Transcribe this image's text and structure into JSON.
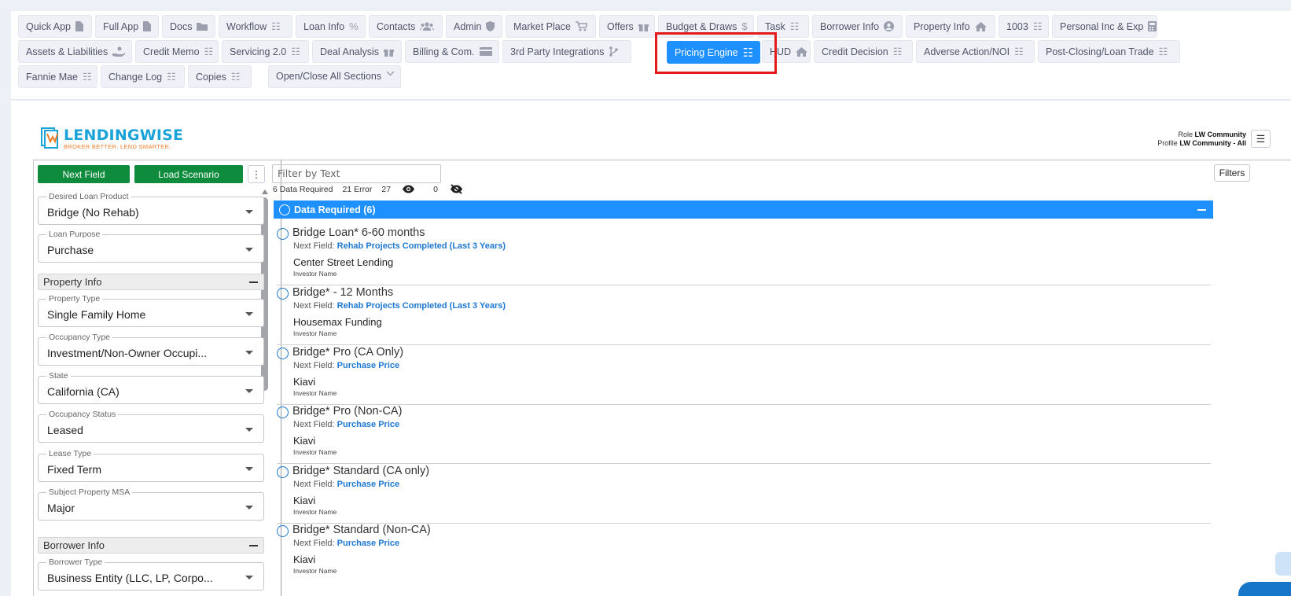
{
  "tabs_row1": [
    {
      "label": "Quick App",
      "icon": "file-icon"
    },
    {
      "label": "Full App",
      "icon": "file-icon"
    },
    {
      "label": "Docs",
      "icon": "folder-icon"
    },
    {
      "label": "Workflow",
      "icon": "list-icon"
    },
    {
      "label": "Loan Info",
      "icon": "percent-icon"
    },
    {
      "label": "Contacts",
      "icon": "users-icon"
    },
    {
      "label": "Admin",
      "icon": "shield-icon"
    },
    {
      "label": "Market Place",
      "icon": "cart-icon"
    },
    {
      "label": "Offers",
      "icon": "gift-icon"
    },
    {
      "label": "Budget & Draws",
      "icon": "dollar-icon"
    },
    {
      "label": "Task",
      "icon": "list-icon"
    },
    {
      "label": "Borrower Info",
      "icon": "user-circle-icon"
    },
    {
      "label": "Property Info",
      "icon": "home-icon"
    },
    {
      "label": "1003",
      "icon": "list-icon"
    },
    {
      "label": "Personal Inc & Exp",
      "icon": "calculator-icon"
    }
  ],
  "tabs_row2": [
    {
      "label": "Assets & Liabilities",
      "icon": "hand-coins-icon"
    },
    {
      "label": "Credit Memo",
      "icon": "list-icon"
    },
    {
      "label": "Servicing 2.0",
      "icon": "list-icon"
    },
    {
      "label": "Deal Analysis",
      "icon": "gift-icon"
    },
    {
      "label": "Billing & Com.",
      "icon": "credit-card-icon"
    },
    {
      "label": "3rd Party Integrations",
      "icon": "branch-icon"
    },
    {
      "label": "Pricing Engine",
      "icon": "list-icon"
    },
    {
      "label": "HUD",
      "icon": "home-icon"
    },
    {
      "label": "Credit Decision",
      "icon": "list-icon"
    },
    {
      "label": "Adverse Action/NOI",
      "icon": "list-icon"
    },
    {
      "label": "Post-Closing/Loan Trade",
      "icon": "list-icon"
    }
  ],
  "tabs_row3": [
    {
      "label": "Fannie Mae",
      "icon": "list-icon"
    },
    {
      "label": "Change Log",
      "icon": "list-icon"
    },
    {
      "label": "Copies",
      "icon": "list-icon"
    },
    {
      "label": "Open/Close All Sections",
      "icon": "chevron-down-icon"
    }
  ],
  "brand": {
    "name": "LENDINGWISE",
    "tagline": "BROKER BETTER. LEND SMARTER."
  },
  "user": {
    "role_label": "Role",
    "role_value": "LW Community",
    "profile_label": "Profile",
    "profile_value": "LW Community - All"
  },
  "left_panel": {
    "next_field_button": "Next Field",
    "load_scenario_button": "Load Scenario",
    "fields_top": [
      {
        "label": "Desired Loan Product",
        "value": "Bridge (No Rehab)"
      },
      {
        "label": "Loan Purpose",
        "value": "Purchase"
      }
    ],
    "property_section": "Property Info",
    "property_fields": [
      {
        "label": "Property Type",
        "value": "Single Family Home"
      },
      {
        "label": "Occupancy Type",
        "value": "Investment/Non-Owner Occupi..."
      },
      {
        "label": "State",
        "value": "California (CA)"
      },
      {
        "label": "Occupancy Status",
        "value": "Leased"
      },
      {
        "label": "Lease Type",
        "value": "Fixed Term"
      },
      {
        "label": "Subject Property MSA",
        "value": "Major"
      }
    ],
    "borrower_section": "Borrower Info",
    "borrower_fields": [
      {
        "label": "Borrower Type",
        "value": "Business Entity (LLC, LP, Corpo..."
      }
    ]
  },
  "right_panel": {
    "filter_placeholder": "Filter by Text",
    "filters_button": "Filters",
    "stats": {
      "data_required": "6 Data Required",
      "error": "21 Error",
      "visible": "27",
      "hidden": "0"
    },
    "section_title": "Data Required (6)",
    "next_field_label": "Next Field:",
    "investor_label": "Investor Name",
    "items": [
      {
        "title": "Bridge Loan* 6-60 months",
        "next_field": "Rehab Projects Completed (Last 3 Years)",
        "investor": "Center Street Lending"
      },
      {
        "title": "Bridge* - 12 Months",
        "next_field": "Rehab Projects Completed (Last 3 Years)",
        "investor": "Housemax Funding"
      },
      {
        "title": "Bridge* Pro (CA Only)",
        "next_field": "Purchase Price",
        "investor": "Kiavi"
      },
      {
        "title": "Bridge* Pro (Non-CA)",
        "next_field": "Purchase Price",
        "investor": "Kiavi"
      },
      {
        "title": "Bridge* Standard (CA only)",
        "next_field": "Purchase Price",
        "investor": "Kiavi"
      },
      {
        "title": "Bridge* Standard (Non-CA)",
        "next_field": "Purchase Price",
        "investor": "Kiavi"
      }
    ]
  },
  "colors": {
    "accent": "#1e90ff",
    "green": "#0f8b3d",
    "highlight": "#e41a1a",
    "link": "#1e78d2"
  }
}
